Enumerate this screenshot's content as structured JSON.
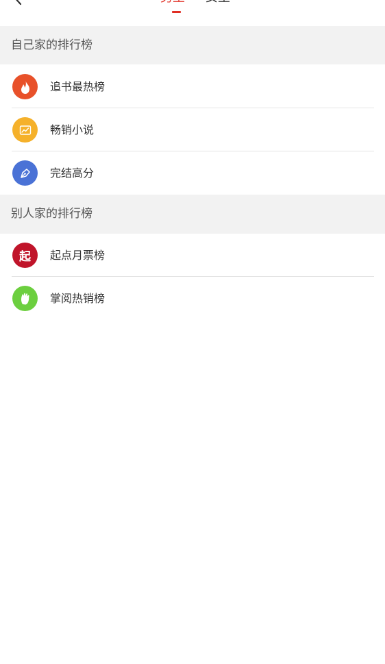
{
  "header": {
    "tabs": [
      {
        "label": "男生",
        "active": true
      },
      {
        "label": "女生",
        "active": false
      }
    ],
    "accent_color": "#e02e24"
  },
  "sections": [
    {
      "title": "自己家的排行榜",
      "items": [
        {
          "label": "追书最热榜",
          "icon": "fire-icon",
          "color": "#e8512a"
        },
        {
          "label": "畅销小说",
          "icon": "trending-chart-icon",
          "color": "#f5b12b"
        },
        {
          "label": "完结高分",
          "icon": "pen-nib-icon",
          "color": "#4a72d6"
        }
      ]
    },
    {
      "title": "别人家的排行榜",
      "items": [
        {
          "label": "起点月票榜",
          "icon": "qidian-logo-icon",
          "icon_text": "起",
          "color": "#c0142a"
        },
        {
          "label": "掌阅热销榜",
          "icon": "palm-hand-icon",
          "color": "#6ccf3f"
        }
      ]
    }
  ]
}
